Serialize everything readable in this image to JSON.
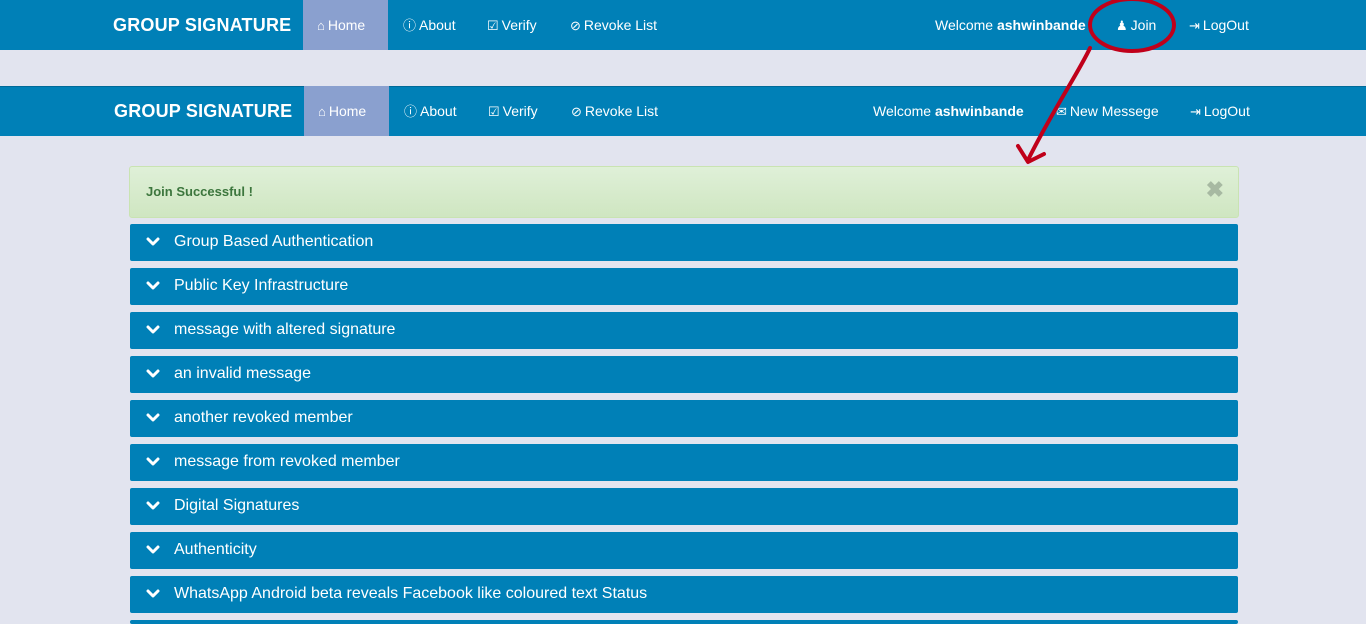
{
  "nav_top": {
    "brand": "GROUP SIGNATURE",
    "items": [
      {
        "label": "Home",
        "icon": "home-icon"
      },
      {
        "label": "About",
        "icon": "info-icon"
      },
      {
        "label": "Verify",
        "icon": "check-square-icon"
      },
      {
        "label": "Revoke List",
        "icon": "ban-icon"
      }
    ],
    "welcome_prefix": "Welcome ",
    "username": "ashwinbande",
    "join_label": "Join",
    "logout_label": "LogOut"
  },
  "nav_bottom": {
    "brand": "GROUP SIGNATURE",
    "items": [
      {
        "label": "Home",
        "icon": "home-icon"
      },
      {
        "label": "About",
        "icon": "info-icon"
      },
      {
        "label": "Verify",
        "icon": "check-square-icon"
      },
      {
        "label": "Revoke List",
        "icon": "ban-icon"
      }
    ],
    "welcome_prefix": "Welcome ",
    "username": "ashwinbande",
    "new_message_label": "New Messege",
    "logout_label": "LogOut"
  },
  "alert": {
    "message": "Join Successful !",
    "close_glyph": "✖"
  },
  "accordion": [
    "Group Based Authentication",
    "Public Key Infrastructure",
    "message with altered signature",
    "an invalid message",
    "another revoked member",
    "message from revoked member",
    "Digital Signatures",
    "Authenticity",
    "WhatsApp Android beta reveals Facebook like coloured text Status"
  ],
  "colors": {
    "navbar": "#0080b7",
    "active_nav": "#8aa0cf",
    "page_bg": "#e2e4ef",
    "alert_bg": "#dff0d8",
    "annotation": "#c0001a"
  }
}
